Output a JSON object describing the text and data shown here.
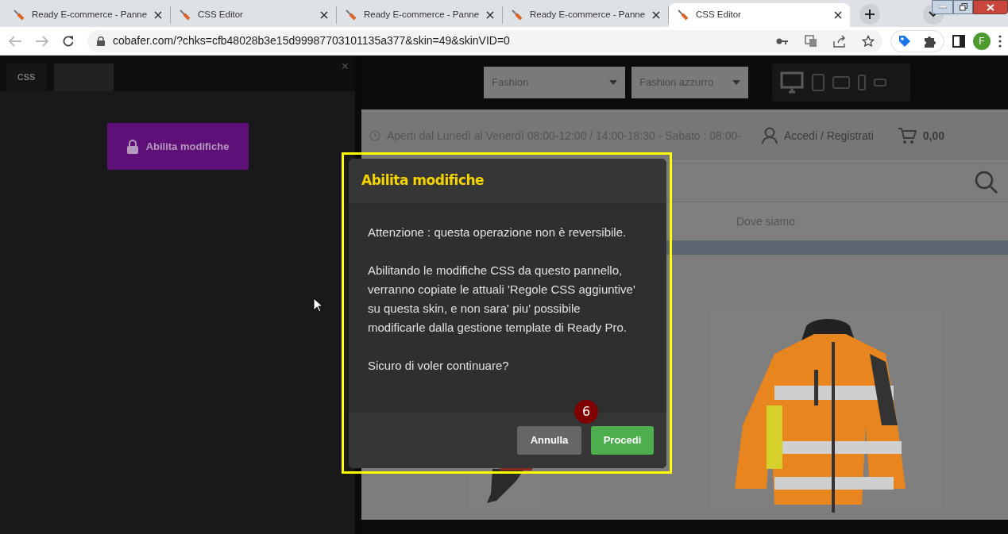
{
  "browser": {
    "tabs": [
      {
        "title": "Ready E-commerce - Panne",
        "selected": false
      },
      {
        "title": "CSS Editor",
        "selected": false
      },
      {
        "title": "Ready E-commerce - Panne",
        "selected": false
      },
      {
        "title": "Ready E-commerce - Panne",
        "selected": false
      },
      {
        "title": "CSS Editor",
        "selected": true
      }
    ],
    "url": "cobafer.com/?chks=cfb48028b3e15d99987703101135a377&skin=49&skinVID=0",
    "profile_initial": "F"
  },
  "editor_panel": {
    "tabs": [
      {
        "label": "CSS",
        "selected": true
      },
      {
        "selected": false
      }
    ],
    "close": "×",
    "enable_button": "Abilita modifiche"
  },
  "site": {
    "selects": [
      "Fashion",
      "Fashion azzurro"
    ],
    "opening_hours": "Aperti dal Lunedì al Venerdì 08:00-12:00 / 14:00-18:30 - Sabato : 08:00-",
    "login": "Accedi / Registrati",
    "cart_total": "0,00",
    "nav": [
      "Dove siamo"
    ]
  },
  "dialog": {
    "title": "Abilita modifiche",
    "paragraphs": [
      "Attenzione : questa operazione non è reversibile.",
      "Abilitando le modifiche CSS da questo pannello, verranno copiate le attuali 'Regole CSS aggiuntive' su questa skin, e non sara' piu' possibile modificarle dalla gestione template di Ready Pro.",
      "Sicuro di voler continuare?"
    ],
    "buttons": [
      {
        "label": "Annulla",
        "kind": "secondary"
      },
      {
        "label": "Procedi",
        "kind": "primary"
      }
    ]
  },
  "annotation": {
    "step": "6"
  }
}
